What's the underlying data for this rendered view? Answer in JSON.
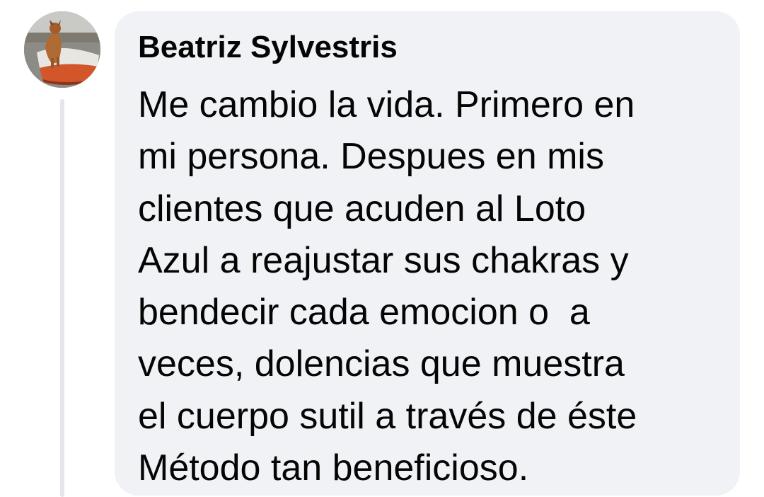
{
  "comment": {
    "author": "Beatriz Sylvestris",
    "text_lines": [
      "Me cambio la vida. Primero en",
      "mi persona. Despues en mis",
      "clientes que acuden al Loto",
      "Azul a reajustar sus chakras y",
      "bendecir cada emocion o  a",
      "veces, dolencias que muestra",
      "el cuerpo sutil a través de éste",
      "Método tan beneficioso."
    ]
  },
  "colors": {
    "bubble_background": "#f0f2f5",
    "text": "#050505",
    "thread_line": "#e4e6eb"
  },
  "icons": {
    "avatar": "profile-photo-dog-on-boat"
  }
}
